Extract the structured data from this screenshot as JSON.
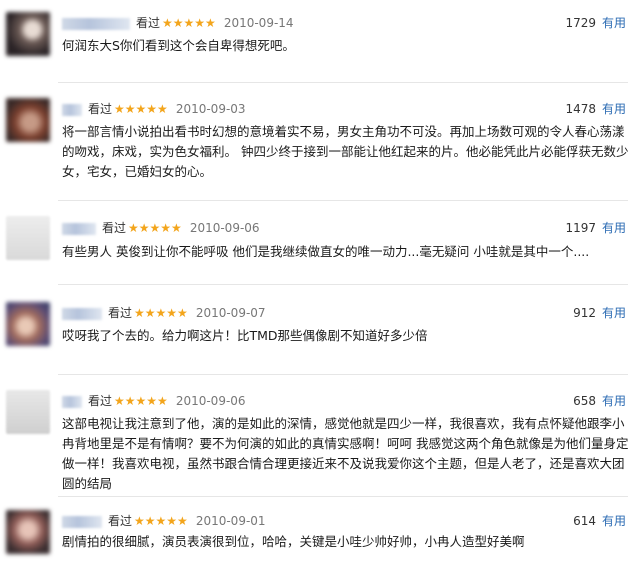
{
  "ui": {
    "status_label": "看过",
    "useful_label": "有用",
    "star_color": "#f3a51c",
    "useful_color": "#2b6bb3"
  },
  "comments": [
    {
      "stars": "★★★★★",
      "date": "2010-09-14",
      "votes": "1729",
      "text": "何润东大S你们看到这个会自卑得想死吧。"
    },
    {
      "stars": "★★★★★",
      "date": "2010-09-03",
      "votes": "1478",
      "text": "将一部言情小说拍出看书时幻想的意境着实不易，男女主角功不可没。再加上场数可观的令人春心荡漾的吻戏，床戏，实为色女福利。 钟四少终于接到一部能让他红起来的片。他必能凭此片必能俘获无数少女，宅女，已婚妇女的心。"
    },
    {
      "stars": "★★★★★",
      "date": "2010-09-06",
      "votes": "1197",
      "text": "有些男人 英俊到让你不能呼吸 他们是我继续做直女的唯一动力...毫无疑问 小哇就是其中一个...."
    },
    {
      "stars": "★★★★★",
      "date": "2010-09-07",
      "votes": "912",
      "text": "哎呀我了个去的。给力啊这片！比TMD那些偶像剧不知道好多少倍"
    },
    {
      "stars": "★★★★★",
      "date": "2010-09-06",
      "votes": "658",
      "text": "这部电视让我注意到了他，演的是如此的深情，感觉他就是四少一样，我很喜欢，我有点怀疑他跟李小冉背地里是不是有情啊？要不为何演的如此的真情实感啊！呵呵 我感觉这两个角色就像是为他们量身定做一样！我喜欢电视，虽然书跟合情合理更接近来不及说我爱你这个主题，但是人老了，还是喜欢大团圆的结局"
    },
    {
      "stars": "★★★★★",
      "date": "2010-09-01",
      "votes": "614",
      "text": "剧情拍的很细腻，演员表演很到位，哈哈，关键是小哇少帅好帅，小冉人造型好美啊"
    }
  ]
}
